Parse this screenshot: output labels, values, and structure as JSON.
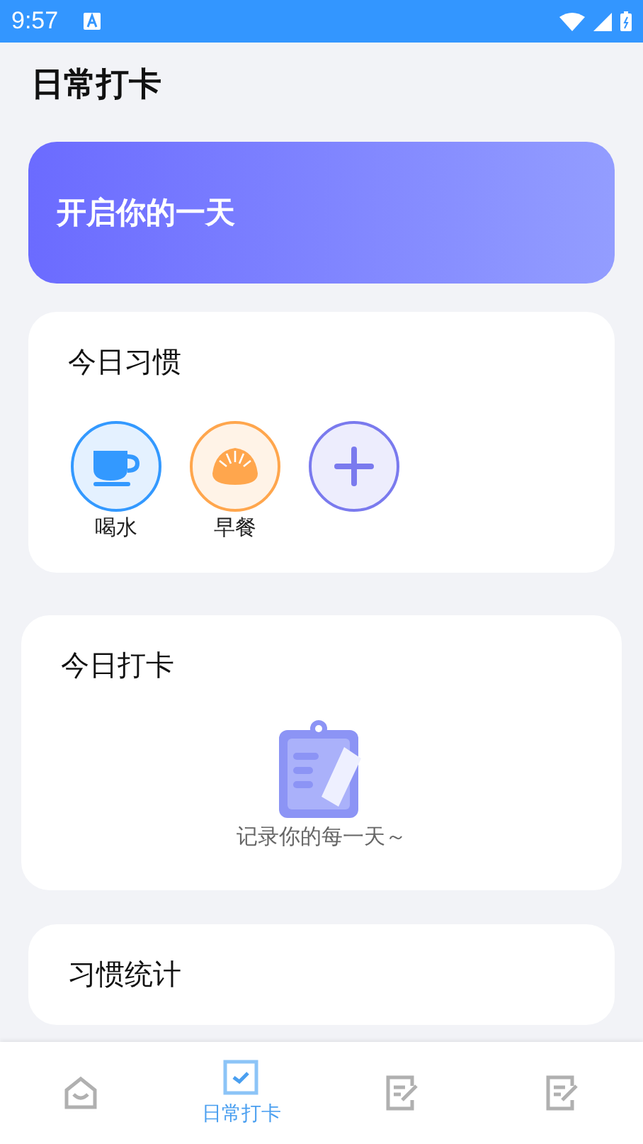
{
  "status_bar": {
    "time": "9:57"
  },
  "header": {
    "title": "日常打卡"
  },
  "banner": {
    "text": "开启你的一天"
  },
  "habits_card": {
    "title": "今日习惯",
    "items": [
      {
        "kind": "cup",
        "label": "喝水",
        "color": "#3399ff"
      },
      {
        "kind": "bun",
        "label": "早餐",
        "color": "#ffa64d"
      },
      {
        "kind": "add",
        "color": "#7a7aee"
      }
    ]
  },
  "checkin_card": {
    "title": "今日打卡",
    "empty_text": "记录你的每一天～"
  },
  "stats_card": {
    "title": "习惯统计"
  },
  "tab_bar": [
    {
      "kind": "home",
      "selected": false
    },
    {
      "kind": "check",
      "label": "日常打卡",
      "selected": true
    },
    {
      "kind": "note",
      "selected": false
    },
    {
      "kind": "note",
      "selected": false
    }
  ]
}
